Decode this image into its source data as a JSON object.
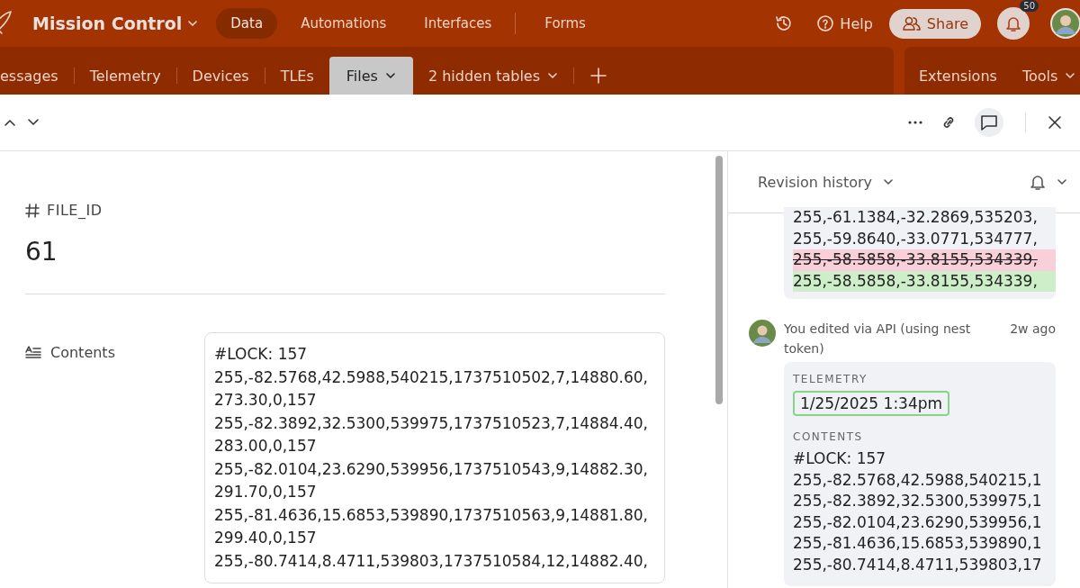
{
  "app": {
    "title": "Mission Control",
    "nav": [
      {
        "label": "Data",
        "selected": true
      },
      {
        "label": "Automations",
        "selected": false
      },
      {
        "label": "Interfaces",
        "selected": false
      },
      {
        "label": "Forms",
        "selected": false
      }
    ],
    "help": "Help",
    "share": "Share",
    "notification_count": "50"
  },
  "tables": {
    "tabs": [
      {
        "label": "essages",
        "selected": false,
        "dropdown": false
      },
      {
        "label": "Telemetry",
        "selected": false,
        "dropdown": false
      },
      {
        "label": "Devices",
        "selected": false,
        "dropdown": false
      },
      {
        "label": "TLEs",
        "selected": false,
        "dropdown": false
      },
      {
        "label": "Files",
        "selected": true,
        "dropdown": true
      }
    ],
    "hidden_tables": "2 hidden tables",
    "extras": [
      "Extensions",
      "Tools"
    ]
  },
  "toolbar": {
    "comments_selected": true
  },
  "record": {
    "fields": [
      {
        "kind": "number",
        "label": "FILE_ID",
        "value": "61"
      },
      {
        "kind": "long_text",
        "label": "Contents",
        "value": "#LOCK: 157\n255,-82.5768,42.5988,540215,1737510502,7,14880.60,\n273.30,0,157\n255,-82.3892,32.5300,539975,1737510523,7,14884.40,\n283.00,0,157\n255,-82.0104,23.6290,539956,1737510543,9,14882.30,\n291.70,0,157\n255,-81.4636,15.6853,539890,1737510563,9,14881.80,\n299.40,0,157\n255,-80.7414,8.4711,539803,1737510584,12,14882.40,"
      }
    ]
  },
  "revision_panel": {
    "title": "Revision history",
    "earlier_lines": [
      {
        "text": "255,-61.1384,-32.2869,535203,",
        "kind": "none"
      },
      {
        "text": "255,-59.8640,-33.0771,534777,",
        "kind": "none"
      },
      {
        "text": "255,-58.5858,-33.8155,534339,",
        "kind": "removed"
      },
      {
        "text": "255,-58.5858,-33.8155,534339,",
        "kind": "added"
      }
    ],
    "entries": [
      {
        "author": "You edited via API (using nest token)",
        "time": "2w ago",
        "changes": [
          {
            "kind": "date",
            "label": "TELEMETRY",
            "value": "1/25/2025 1:34pm",
            "added": true
          },
          {
            "kind": "text",
            "label": "CONTENTS",
            "lines": [
              "#LOCK: 157",
              "255,-82.5768,42.5988,540215,1",
              "255,-82.3892,32.5300,539975,1",
              "255,-82.0104,23.6290,539956,1",
              "255,-81.4636,15.6853,539890,1",
              "255,-80.7414,8.4711,539803,17"
            ]
          }
        ]
      }
    ]
  }
}
